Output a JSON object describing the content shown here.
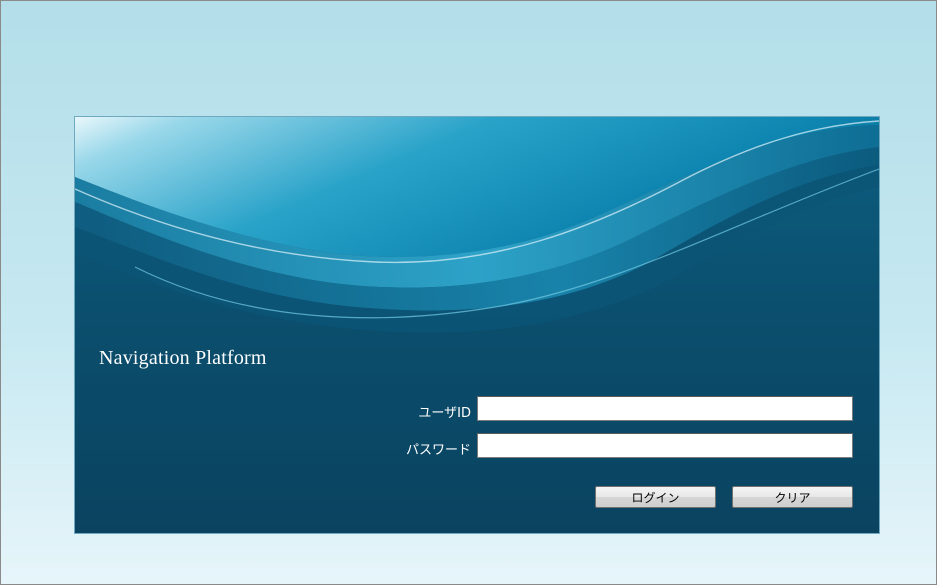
{
  "product_title": "Navigation Platform",
  "form": {
    "userid_label": "ユーザID",
    "userid_value": "",
    "password_label": "パスワード",
    "password_value": "",
    "login_button": "ログイン",
    "clear_button": "クリア"
  },
  "colors": {
    "page_background_top": "#b3dee9",
    "page_background_bottom": "#e6f5fa",
    "panel_background": "#0b4662",
    "wave_light": "#7fd0e6",
    "title_text": "#ffffff"
  }
}
